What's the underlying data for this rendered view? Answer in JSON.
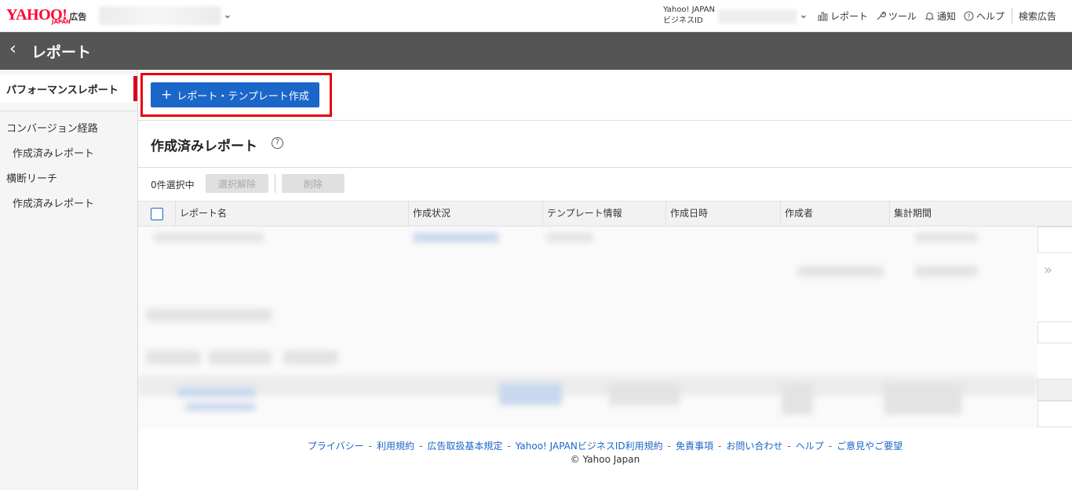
{
  "header": {
    "logo_text": "YAHOO!",
    "logo_sub": "JAPAN",
    "logo_ad": "広告",
    "bizid_line1": "Yahoo! JAPAN",
    "bizid_line2": "ビジネスID",
    "nav": {
      "report": "レポート",
      "tool": "ツール",
      "notify": "通知",
      "help": "ヘルプ",
      "search_ad": "検索広告"
    }
  },
  "titlebar": {
    "title": "レポート"
  },
  "sidebar": {
    "active": "パフォーマンスレポート",
    "items": [
      {
        "label": "コンバージョン経路"
      },
      {
        "label": "作成済みレポート"
      },
      {
        "label": "横断リーチ"
      },
      {
        "label": "作成済みレポート"
      }
    ]
  },
  "main": {
    "create_button": "レポート・テンプレート作成",
    "section_title": "作成済みレポート",
    "selection_count": "0件選択中",
    "unselect_button": "選択解除",
    "delete_button": "削除",
    "table_headers": [
      "レポート名",
      "作成状況",
      "テンプレート情報",
      "作成日時",
      "作成者",
      "集計期間"
    ]
  },
  "footer": {
    "links": [
      "プライバシー",
      "利用規約",
      "広告取扱基本規定",
      "Yahoo! JAPANビジネスID利用規約",
      "免責事項",
      "お問い合わせ",
      "ヘルプ",
      "ご意見やご要望"
    ],
    "separator": "-",
    "copyright": "© Yahoo Japan"
  },
  "colors": {
    "primary_button": "#1b66c9",
    "highlight_border": "#e60012",
    "titlebar_bg": "#555555",
    "logo_red": "#ff0033"
  }
}
